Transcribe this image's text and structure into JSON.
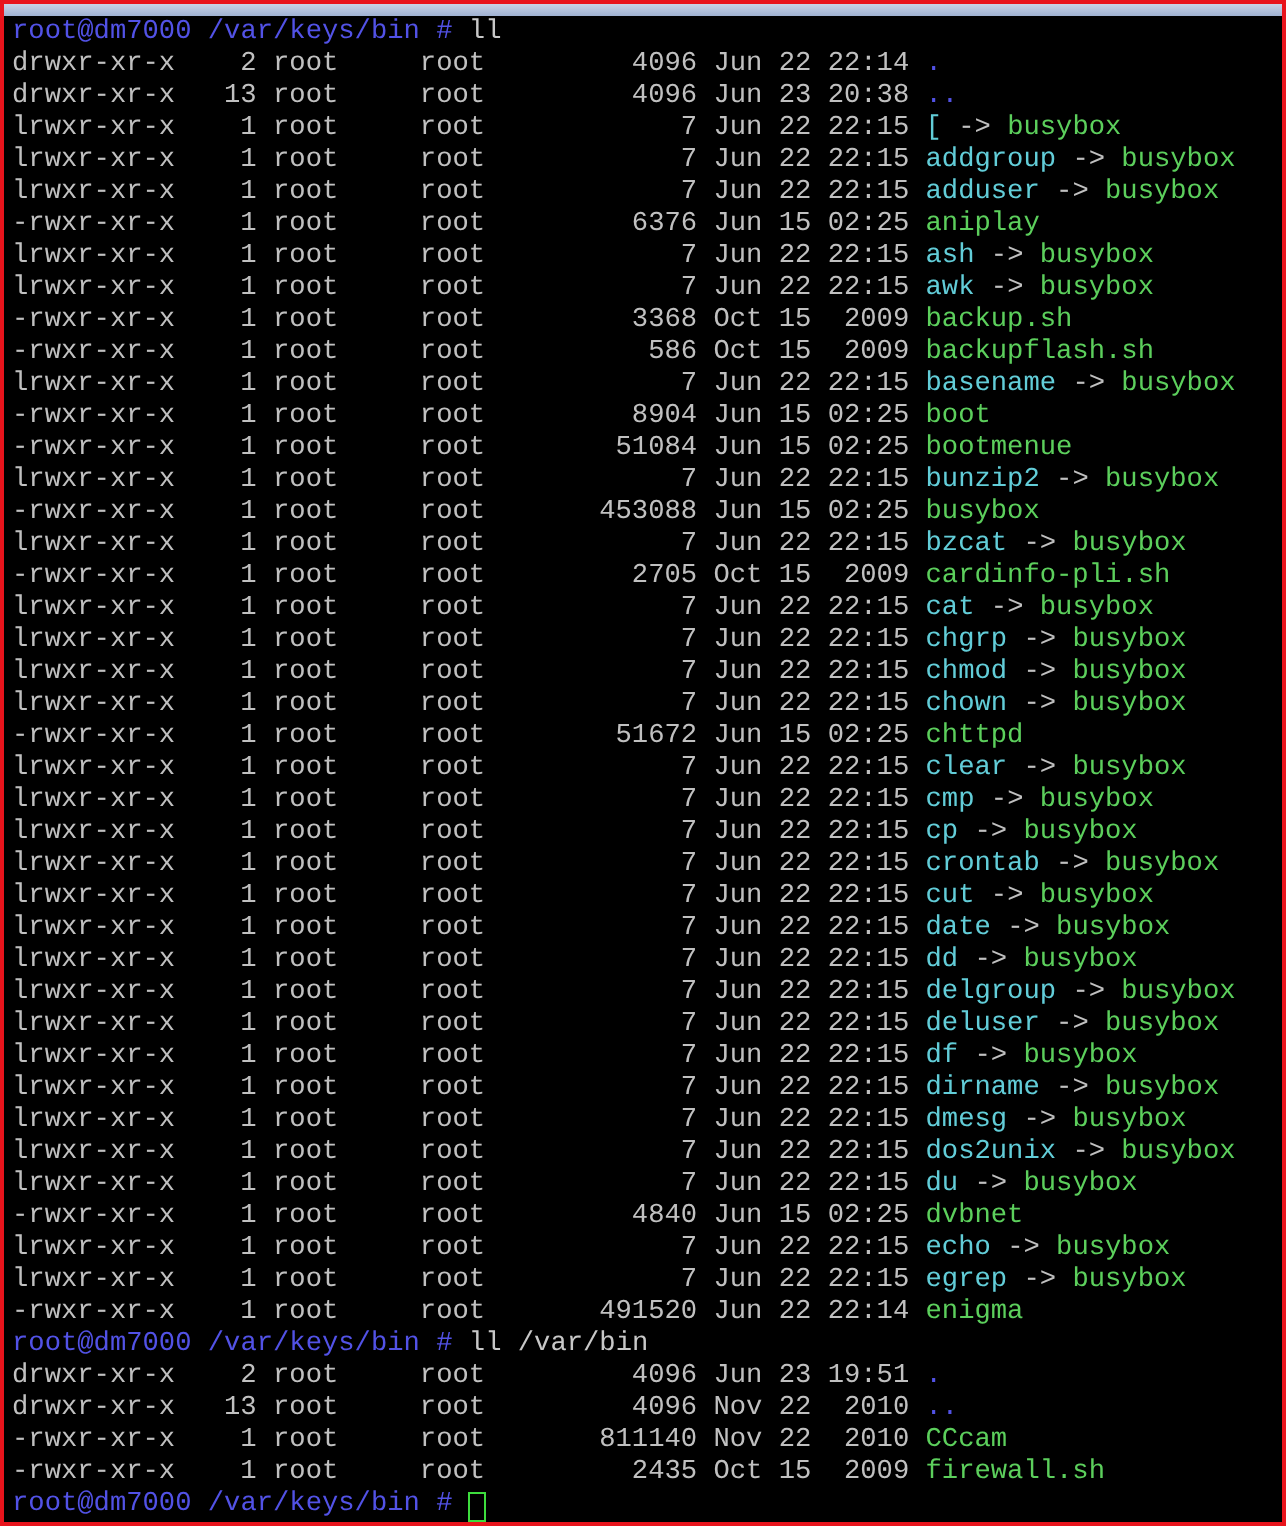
{
  "blocks": [
    {
      "prompt": "root@dm7000 /var/keys/bin #",
      "command": "ll",
      "entries": [
        {
          "kind": "dir",
          "mode": "drwxr-xr-x",
          "links": "2",
          "owner": "root",
          "group": "root",
          "size": "4096",
          "date": "Jun 22 22:14",
          "name": "."
        },
        {
          "kind": "dir",
          "mode": "drwxr-xr-x",
          "links": "13",
          "owner": "root",
          "group": "root",
          "size": "4096",
          "date": "Jun 23 20:38",
          "name": ".."
        },
        {
          "kind": "link",
          "mode": "lrwxr-xr-x",
          "links": "1",
          "owner": "root",
          "group": "root",
          "size": "7",
          "date": "Jun 22 22:15",
          "name": "[",
          "arrow": "->",
          "target": "busybox"
        },
        {
          "kind": "link",
          "mode": "lrwxr-xr-x",
          "links": "1",
          "owner": "root",
          "group": "root",
          "size": "7",
          "date": "Jun 22 22:15",
          "name": "addgroup",
          "arrow": "->",
          "target": "busybox"
        },
        {
          "kind": "link",
          "mode": "lrwxr-xr-x",
          "links": "1",
          "owner": "root",
          "group": "root",
          "size": "7",
          "date": "Jun 22 22:15",
          "name": "adduser",
          "arrow": "->",
          "target": "busybox"
        },
        {
          "kind": "exec",
          "mode": "-rwxr-xr-x",
          "links": "1",
          "owner": "root",
          "group": "root",
          "size": "6376",
          "date": "Jun 15 02:25",
          "name": "aniplay"
        },
        {
          "kind": "link",
          "mode": "lrwxr-xr-x",
          "links": "1",
          "owner": "root",
          "group": "root",
          "size": "7",
          "date": "Jun 22 22:15",
          "name": "ash",
          "arrow": "->",
          "target": "busybox"
        },
        {
          "kind": "link",
          "mode": "lrwxr-xr-x",
          "links": "1",
          "owner": "root",
          "group": "root",
          "size": "7",
          "date": "Jun 22 22:15",
          "name": "awk",
          "arrow": "->",
          "target": "busybox"
        },
        {
          "kind": "exec",
          "mode": "-rwxr-xr-x",
          "links": "1",
          "owner": "root",
          "group": "root",
          "size": "3368",
          "date": "Oct 15  2009",
          "name": "backup.sh"
        },
        {
          "kind": "exec",
          "mode": "-rwxr-xr-x",
          "links": "1",
          "owner": "root",
          "group": "root",
          "size": "586",
          "date": "Oct 15  2009",
          "name": "backupflash.sh"
        },
        {
          "kind": "link",
          "mode": "lrwxr-xr-x",
          "links": "1",
          "owner": "root",
          "group": "root",
          "size": "7",
          "date": "Jun 22 22:15",
          "name": "basename",
          "arrow": "->",
          "target": "busybox"
        },
        {
          "kind": "exec",
          "mode": "-rwxr-xr-x",
          "links": "1",
          "owner": "root",
          "group": "root",
          "size": "8904",
          "date": "Jun 15 02:25",
          "name": "boot"
        },
        {
          "kind": "exec",
          "mode": "-rwxr-xr-x",
          "links": "1",
          "owner": "root",
          "group": "root",
          "size": "51084",
          "date": "Jun 15 02:25",
          "name": "bootmenue"
        },
        {
          "kind": "link",
          "mode": "lrwxr-xr-x",
          "links": "1",
          "owner": "root",
          "group": "root",
          "size": "7",
          "date": "Jun 22 22:15",
          "name": "bunzip2",
          "arrow": "->",
          "target": "busybox"
        },
        {
          "kind": "exec",
          "mode": "-rwxr-xr-x",
          "links": "1",
          "owner": "root",
          "group": "root",
          "size": "453088",
          "date": "Jun 15 02:25",
          "name": "busybox"
        },
        {
          "kind": "link",
          "mode": "lrwxr-xr-x",
          "links": "1",
          "owner": "root",
          "group": "root",
          "size": "7",
          "date": "Jun 22 22:15",
          "name": "bzcat",
          "arrow": "->",
          "target": "busybox"
        },
        {
          "kind": "exec",
          "mode": "-rwxr-xr-x",
          "links": "1",
          "owner": "root",
          "group": "root",
          "size": "2705",
          "date": "Oct 15  2009",
          "name": "cardinfo-pli.sh"
        },
        {
          "kind": "link",
          "mode": "lrwxr-xr-x",
          "links": "1",
          "owner": "root",
          "group": "root",
          "size": "7",
          "date": "Jun 22 22:15",
          "name": "cat",
          "arrow": "->",
          "target": "busybox"
        },
        {
          "kind": "link",
          "mode": "lrwxr-xr-x",
          "links": "1",
          "owner": "root",
          "group": "root",
          "size": "7",
          "date": "Jun 22 22:15",
          "name": "chgrp",
          "arrow": "->",
          "target": "busybox"
        },
        {
          "kind": "link",
          "mode": "lrwxr-xr-x",
          "links": "1",
          "owner": "root",
          "group": "root",
          "size": "7",
          "date": "Jun 22 22:15",
          "name": "chmod",
          "arrow": "->",
          "target": "busybox"
        },
        {
          "kind": "link",
          "mode": "lrwxr-xr-x",
          "links": "1",
          "owner": "root",
          "group": "root",
          "size": "7",
          "date": "Jun 22 22:15",
          "name": "chown",
          "arrow": "->",
          "target": "busybox"
        },
        {
          "kind": "exec",
          "mode": "-rwxr-xr-x",
          "links": "1",
          "owner": "root",
          "group": "root",
          "size": "51672",
          "date": "Jun 15 02:25",
          "name": "chttpd"
        },
        {
          "kind": "link",
          "mode": "lrwxr-xr-x",
          "links": "1",
          "owner": "root",
          "group": "root",
          "size": "7",
          "date": "Jun 22 22:15",
          "name": "clear",
          "arrow": "->",
          "target": "busybox"
        },
        {
          "kind": "link",
          "mode": "lrwxr-xr-x",
          "links": "1",
          "owner": "root",
          "group": "root",
          "size": "7",
          "date": "Jun 22 22:15",
          "name": "cmp",
          "arrow": "->",
          "target": "busybox"
        },
        {
          "kind": "link",
          "mode": "lrwxr-xr-x",
          "links": "1",
          "owner": "root",
          "group": "root",
          "size": "7",
          "date": "Jun 22 22:15",
          "name": "cp",
          "arrow": "->",
          "target": "busybox"
        },
        {
          "kind": "link",
          "mode": "lrwxr-xr-x",
          "links": "1",
          "owner": "root",
          "group": "root",
          "size": "7",
          "date": "Jun 22 22:15",
          "name": "crontab",
          "arrow": "->",
          "target": "busybox"
        },
        {
          "kind": "link",
          "mode": "lrwxr-xr-x",
          "links": "1",
          "owner": "root",
          "group": "root",
          "size": "7",
          "date": "Jun 22 22:15",
          "name": "cut",
          "arrow": "->",
          "target": "busybox"
        },
        {
          "kind": "link",
          "mode": "lrwxr-xr-x",
          "links": "1",
          "owner": "root",
          "group": "root",
          "size": "7",
          "date": "Jun 22 22:15",
          "name": "date",
          "arrow": "->",
          "target": "busybox"
        },
        {
          "kind": "link",
          "mode": "lrwxr-xr-x",
          "links": "1",
          "owner": "root",
          "group": "root",
          "size": "7",
          "date": "Jun 22 22:15",
          "name": "dd",
          "arrow": "->",
          "target": "busybox"
        },
        {
          "kind": "link",
          "mode": "lrwxr-xr-x",
          "links": "1",
          "owner": "root",
          "group": "root",
          "size": "7",
          "date": "Jun 22 22:15",
          "name": "delgroup",
          "arrow": "->",
          "target": "busybox"
        },
        {
          "kind": "link",
          "mode": "lrwxr-xr-x",
          "links": "1",
          "owner": "root",
          "group": "root",
          "size": "7",
          "date": "Jun 22 22:15",
          "name": "deluser",
          "arrow": "->",
          "target": "busybox"
        },
        {
          "kind": "link",
          "mode": "lrwxr-xr-x",
          "links": "1",
          "owner": "root",
          "group": "root",
          "size": "7",
          "date": "Jun 22 22:15",
          "name": "df",
          "arrow": "->",
          "target": "busybox"
        },
        {
          "kind": "link",
          "mode": "lrwxr-xr-x",
          "links": "1",
          "owner": "root",
          "group": "root",
          "size": "7",
          "date": "Jun 22 22:15",
          "name": "dirname",
          "arrow": "->",
          "target": "busybox"
        },
        {
          "kind": "link",
          "mode": "lrwxr-xr-x",
          "links": "1",
          "owner": "root",
          "group": "root",
          "size": "7",
          "date": "Jun 22 22:15",
          "name": "dmesg",
          "arrow": "->",
          "target": "busybox"
        },
        {
          "kind": "link",
          "mode": "lrwxr-xr-x",
          "links": "1",
          "owner": "root",
          "group": "root",
          "size": "7",
          "date": "Jun 22 22:15",
          "name": "dos2unix",
          "arrow": "->",
          "target": "busybox"
        },
        {
          "kind": "link",
          "mode": "lrwxr-xr-x",
          "links": "1",
          "owner": "root",
          "group": "root",
          "size": "7",
          "date": "Jun 22 22:15",
          "name": "du",
          "arrow": "->",
          "target": "busybox"
        },
        {
          "kind": "exec",
          "mode": "-rwxr-xr-x",
          "links": "1",
          "owner": "root",
          "group": "root",
          "size": "4840",
          "date": "Jun 15 02:25",
          "name": "dvbnet"
        },
        {
          "kind": "link",
          "mode": "lrwxr-xr-x",
          "links": "1",
          "owner": "root",
          "group": "root",
          "size": "7",
          "date": "Jun 22 22:15",
          "name": "echo",
          "arrow": "->",
          "target": "busybox"
        },
        {
          "kind": "link",
          "mode": "lrwxr-xr-x",
          "links": "1",
          "owner": "root",
          "group": "root",
          "size": "7",
          "date": "Jun 22 22:15",
          "name": "egrep",
          "arrow": "->",
          "target": "busybox"
        },
        {
          "kind": "exec",
          "mode": "-rwxr-xr-x",
          "links": "1",
          "owner": "root",
          "group": "root",
          "size": "491520",
          "date": "Jun 22 22:14",
          "name": "enigma"
        }
      ]
    },
    {
      "prompt": "root@dm7000 /var/keys/bin #",
      "command": "ll /var/bin",
      "entries": [
        {
          "kind": "dir",
          "mode": "drwxr-xr-x",
          "links": "2",
          "owner": "root",
          "group": "root",
          "size": "4096",
          "date": "Jun 23 19:51",
          "name": "."
        },
        {
          "kind": "dir",
          "mode": "drwxr-xr-x",
          "links": "13",
          "owner": "root",
          "group": "root",
          "size": "4096",
          "date": "Nov 22  2010",
          "name": ".."
        },
        {
          "kind": "exec",
          "mode": "-rwxr-xr-x",
          "links": "1",
          "owner": "root",
          "group": "root",
          "size": "811140",
          "date": "Nov 22  2010",
          "name": "CCcam"
        },
        {
          "kind": "exec",
          "mode": "-rwxr-xr-x",
          "links": "1",
          "owner": "root",
          "group": "root",
          "size": "2435",
          "date": "Oct 15  2009",
          "name": "firewall.sh"
        }
      ]
    }
  ],
  "current_prompt": {
    "prompt": "root@dm7000 /var/keys/bin #",
    "cursor": true
  }
}
